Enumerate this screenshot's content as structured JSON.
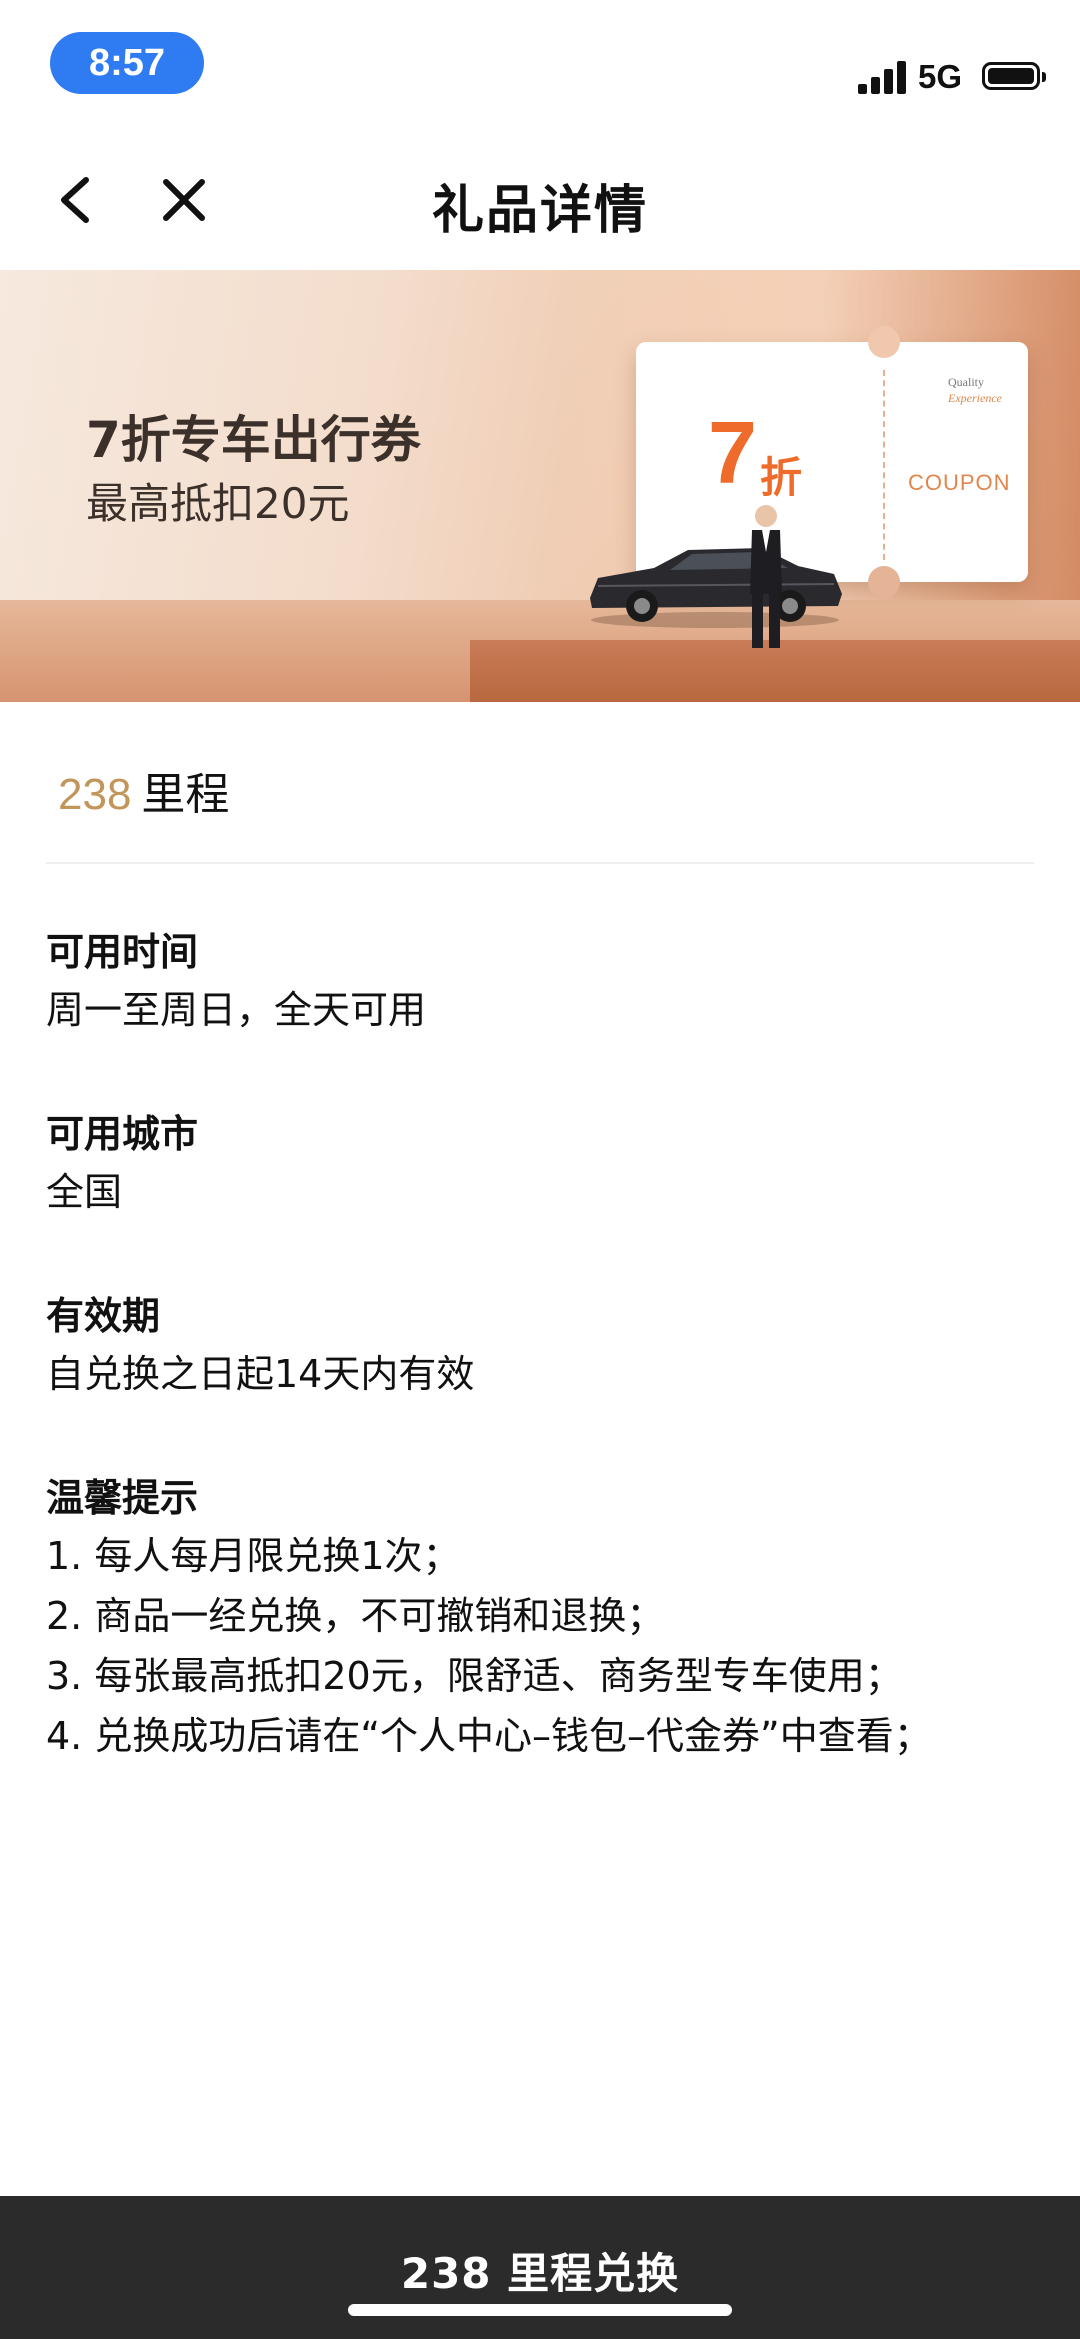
{
  "status_bar": {
    "time": "8:57",
    "network": "5G"
  },
  "nav": {
    "title": "礼品详情"
  },
  "banner": {
    "title": "7折专车出行券",
    "subtitle": "最高抵扣20元",
    "ticket_discount": "7",
    "ticket_unit": "折",
    "ticket_label": "COUPON",
    "ticket_brand_line1": "Quality",
    "ticket_brand_line2": "Experience"
  },
  "price": {
    "amount": "238",
    "unit": "里程"
  },
  "details": [
    {
      "heading": "可用时间",
      "value": "周一至周日，全天可用"
    },
    {
      "heading": "可用城市",
      "value": "全国"
    },
    {
      "heading": "有效期",
      "value": "自兑换之日起14天内有效"
    }
  ],
  "tips": {
    "heading": "温馨提示",
    "items": [
      "1. 每人每月限兑换1次；",
      "2. 商品一经兑换，不可撤销和退换；",
      "3. 每张最高抵扣20元，限舒适、商务型专车使用；",
      "4. 兑换成功后请在“个人中心–钱包–代金券”中查看；"
    ]
  },
  "bottom_button": {
    "label": "238 里程兑换"
  },
  "colors": {
    "accent_price": "#c2955a",
    "coupon_orange": "#ef6b2b",
    "time_pill": "#2f7bf2",
    "bottom_bar": "#2b2b2b"
  }
}
